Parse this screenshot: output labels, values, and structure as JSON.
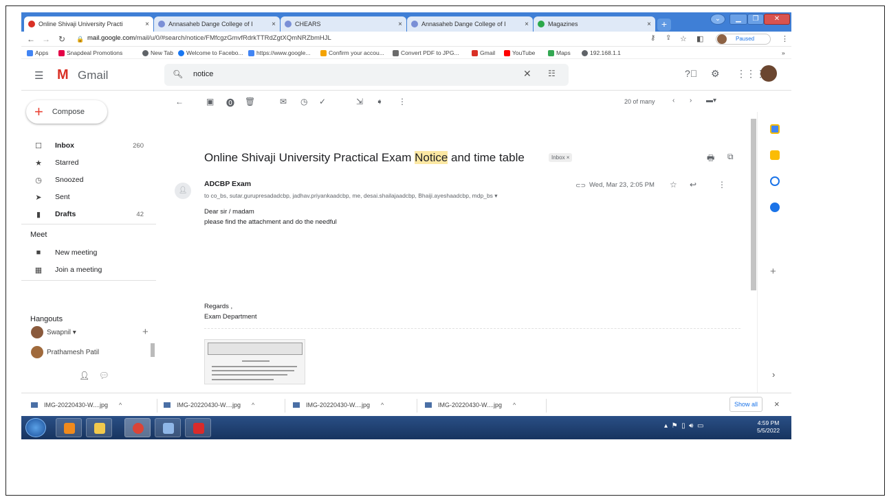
{
  "browser": {
    "tabs": [
      {
        "title": "Online Shivaji University Practi",
        "close": "×",
        "color": "#d93025"
      },
      {
        "title": "Annasaheb Dange College of I",
        "close": "×",
        "color": "#7a8fd6"
      },
      {
        "title": "CHEARS",
        "close": "×",
        "color": "#7a8fd6"
      },
      {
        "title": "Annasaheb Dange College of I",
        "close": "×",
        "color": "#7a8fd6"
      },
      {
        "title": "Magazines",
        "close": "×",
        "color": "#2ba84a"
      }
    ],
    "new_tab": "+",
    "url_prefix": "mail.google.com",
    "url_rest": "/mail/u/0/#search/notice/FMfcgzGmvfRdrkTTRdZgtXQmNRZbmHJL",
    "profile_status": "Paused",
    "bookmarks": [
      {
        "label": "Apps",
        "color": "#4285f4"
      },
      {
        "label": "Snapdeal Promotions",
        "color": "#e40046"
      },
      {
        "label": "New Tab",
        "color": "#5f6368"
      },
      {
        "label": "Welcome to Facebo...",
        "color": "#1877f2"
      },
      {
        "label": "https://www.google...",
        "color": "#4285f4"
      },
      {
        "label": "Confirm your accou...",
        "color": "#f4a300"
      },
      {
        "label": "Convert PDF to JPG...",
        "color": "#6b6b6b"
      },
      {
        "label": "Gmail",
        "color": "#d93025"
      },
      {
        "label": "YouTube",
        "color": "#ff0000"
      },
      {
        "label": "Maps",
        "color": "#34a853"
      },
      {
        "label": "192.168.1.1",
        "color": "#5f6368"
      }
    ],
    "more_bookmarks": "»"
  },
  "gmail": {
    "product": "Gmail",
    "search_value": "notice",
    "compose": "Compose",
    "nav": [
      {
        "label": "Inbox",
        "count": "260",
        "icon": "inbox-icon",
        "glyph": "☐",
        "bold": true
      },
      {
        "label": "Starred",
        "count": "",
        "icon": "star-icon",
        "glyph": "★",
        "bold": false
      },
      {
        "label": "Snoozed",
        "count": "",
        "icon": "clock-icon",
        "glyph": "◷",
        "bold": false
      },
      {
        "label": "Sent",
        "count": "",
        "icon": "send-icon",
        "glyph": "➤",
        "bold": false
      },
      {
        "label": "Drafts",
        "count": "42",
        "icon": "draft-icon",
        "glyph": "▮",
        "bold": true
      }
    ],
    "meet_title": "Meet",
    "meet": [
      {
        "label": "New meeting",
        "glyph": "■"
      },
      {
        "label": "Join a meeting",
        "glyph": "▦"
      }
    ],
    "hangouts_title": "Hangouts",
    "hangouts_user": "Swapnil ▾",
    "hangouts_contact": "Prathamesh Patil",
    "pager": "20 of many"
  },
  "message": {
    "subject_before": "Online Shivaji University Practical Exam ",
    "subject_highlight": "Notice",
    "subject_after": " and time table",
    "label": "Inbox ×",
    "sender": "ADCBP Exam",
    "recipients": "to co_bs, sutar.gurupresadadcbp, jadhav.priyankaadcbp, me, desai.shailajaadcbp, Bhaiji.ayeshaadcbp, mdp_bs ▾",
    "date": "Wed, Mar 23, 2:05 PM",
    "body_line1": "Dear sir / madam",
    "body_line2": "please find the attachment and do the needful",
    "regards": "Regards ,",
    "department": "Exam Department"
  },
  "downloads": {
    "items": [
      "IMG-20220430-W....jpg",
      "IMG-20220430-W....jpg",
      "IMG-20220430-W....jpg",
      "IMG-20220430-W....jpg"
    ],
    "caret": "^",
    "show_all": "Show all",
    "close": "×"
  },
  "taskbar": {
    "time": "4:59 PM",
    "date": "5/5/2022"
  }
}
